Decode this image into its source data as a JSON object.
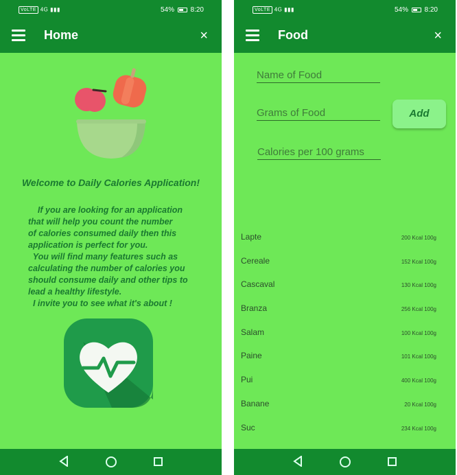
{
  "status_bar": {
    "volte": "VoLTE",
    "network": "4G",
    "battery_percent": "54%",
    "battery_level": 0.54,
    "time": "8:20"
  },
  "home_screen": {
    "title": "Home",
    "close_symbol": "×",
    "welcome_text": "Welcome to Daily Calories Application!",
    "paragraph_lines": [
      "    If you are looking for an application",
      "that will help you count the number",
      "of calories consumed daily then this",
      "application is perfect for you.",
      "  You will find many features such as",
      "calculating the number of calories you",
      "should consume daily and other tips to",
      "lead a healthy lifestyle.",
      "  I invite you to see what it's about !"
    ],
    "icons": [
      "menu-icon",
      "close-icon",
      "apple-pepper-bowl-illustration",
      "heart-pulse-logo"
    ]
  },
  "food_screen": {
    "title": "Food",
    "close_symbol": "×",
    "name_placeholder": "Name of Food",
    "grams_placeholder": "Grams of Food",
    "calories_placeholder": "Calories per 100 grams",
    "add_button": "Add",
    "items": [
      {
        "name": "Lapte",
        "kcal": "200 Kcal 100g"
      },
      {
        "name": "Cereale",
        "kcal": "152 Kcal 100g"
      },
      {
        "name": "Cascaval",
        "kcal": "130 Kcal 100g"
      },
      {
        "name": "Branza",
        "kcal": "256 Kcal 100g"
      },
      {
        "name": "Salam",
        "kcal": "100 Kcal 100g"
      },
      {
        "name": "Paine",
        "kcal": "101 Kcal 100g"
      },
      {
        "name": "Pui",
        "kcal": "400 Kcal 100g"
      },
      {
        "name": "Banane",
        "kcal": "20 Kcal 100g"
      },
      {
        "name": "Suc",
        "kcal": "234 Kcal 100g"
      }
    ]
  },
  "nav_bar": {
    "icons": [
      "back-icon",
      "home-icon",
      "recents-icon"
    ]
  },
  "colors": {
    "app_bar": "#128a2e",
    "background": "#6ee857",
    "text_dark_green": "#1a7a30",
    "add_button": "#8bf28a"
  }
}
